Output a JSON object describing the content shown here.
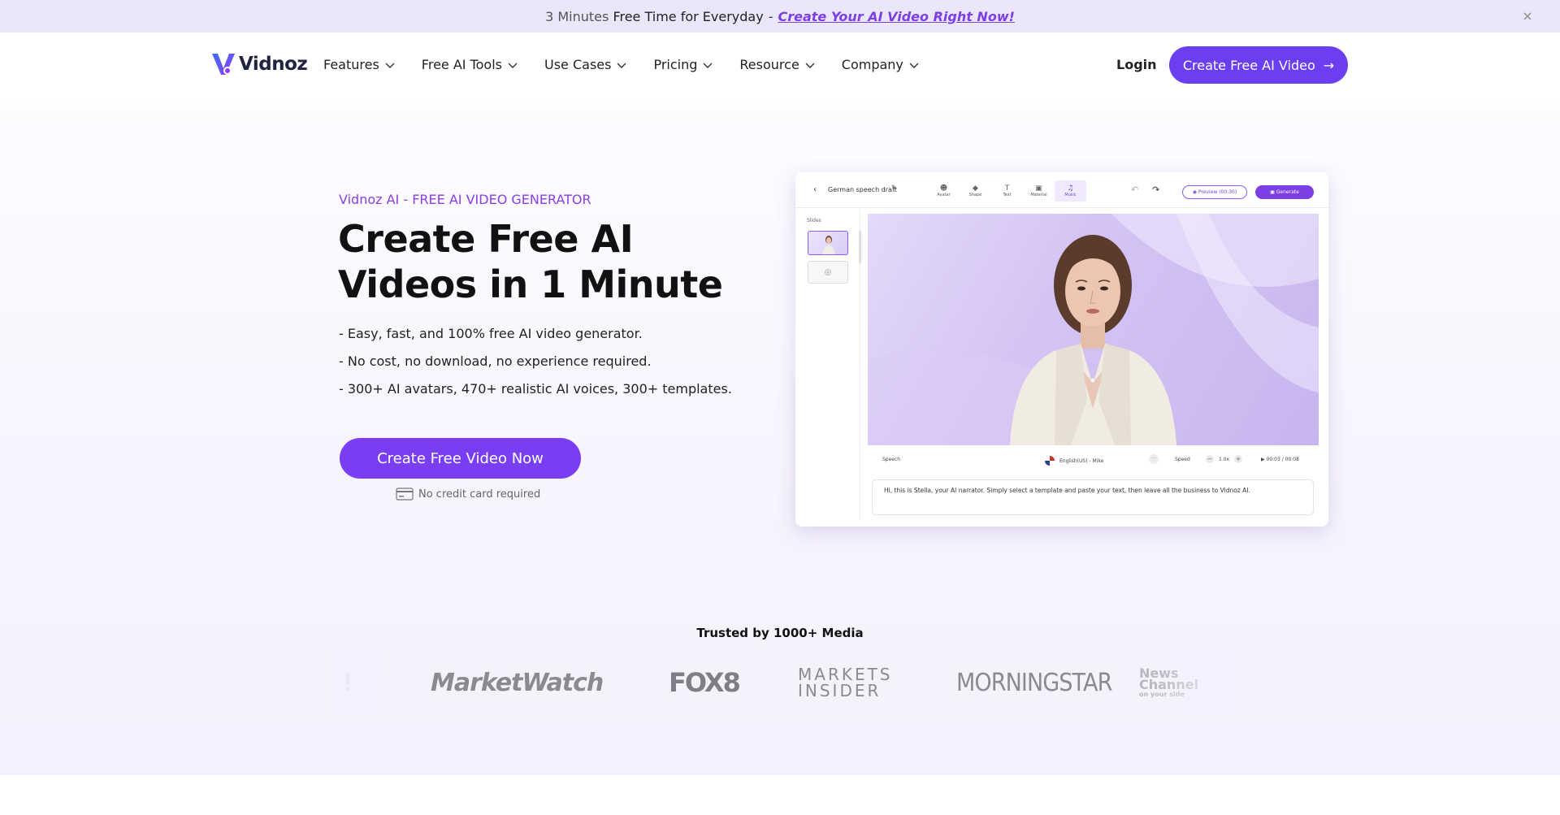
{
  "promo": {
    "lead_muted": "3 Minutes",
    "lead": "Free Time for Everyday",
    "separator": "-",
    "link": "Create Your AI Video Right Now!",
    "close": "×"
  },
  "nav": {
    "logo_text": "Vidnoz",
    "menu": [
      {
        "label": "Features"
      },
      {
        "label": "Free AI Tools"
      },
      {
        "label": "Use Cases"
      },
      {
        "label": "Pricing"
      },
      {
        "label": "Resource"
      },
      {
        "label": "Company"
      }
    ],
    "login": "Login",
    "cta": "Create Free AI Video",
    "cta_arrow": "→"
  },
  "hero": {
    "eyebrow": "Vidnoz AI - FREE AI VIDEO GENERATOR",
    "title": "Create Free AI Videos in 1 Minute",
    "bullets": [
      "- Easy, fast, and 100% free AI video generator.",
      "- No cost, no download, no experience required.",
      "- 300+ AI avatars, 470+ realistic AI voices, 300+ templates."
    ],
    "cta": "Create Free Video Now",
    "note": "No credit card required"
  },
  "editor": {
    "back_icon": "‹",
    "draft_title": "German speech draft",
    "edit_icon": "✎",
    "tools": [
      {
        "icon": "☻",
        "label": "Avatar"
      },
      {
        "icon": "◆",
        "label": "Shape"
      },
      {
        "icon": "T",
        "label": "Text"
      },
      {
        "icon": "▣",
        "label": "Material"
      },
      {
        "icon": "♫",
        "label": "Music"
      }
    ],
    "undo_icon": "↶",
    "redo_icon": "↷",
    "preview": "◉ Preview (00:30)",
    "generate": "▣ Generate",
    "slides_label": "Slides",
    "add_slide": "⊕",
    "speech_label": "Speech",
    "voice": "English(US) - Mike",
    "dots": "···",
    "speed_label": "Speed",
    "speed_minus": "−",
    "speed_value": "1.0x",
    "speed_plus": "+",
    "time": "▶  00:03 / 00:08",
    "script": "Hi, this is Stella, your AI narrator. Simply select a template and paste your text, then leave all the business to Vidnoz AI."
  },
  "trusted": {
    "title": "Trusted by 1000+ Media",
    "brands": {
      "partial": "!",
      "marketwatch": "MarketWatch",
      "fox8": "FOX8",
      "markets_insider_1": "MARKETS",
      "markets_insider_2": "INSIDER",
      "morningstar": "MORNINGSTAR",
      "news_channel_1": "News",
      "news_channel_2": "Channel",
      "news_channel_3": "on your side"
    }
  },
  "colors": {
    "brand_purple": "#6b3ff0",
    "accent_purple": "#8a3fe0",
    "promo_bg": "#ebe7fb"
  }
}
